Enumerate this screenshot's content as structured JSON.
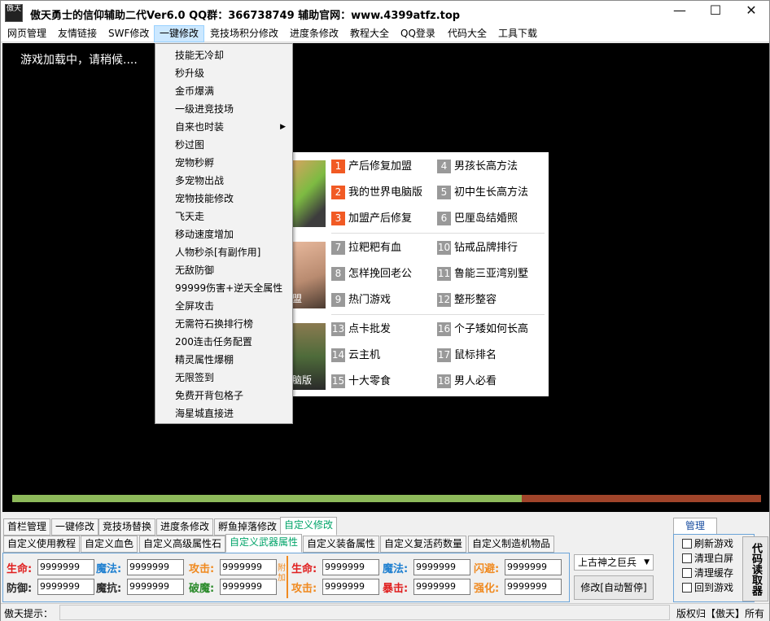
{
  "window": {
    "icon_text": "傲天",
    "title": "傲天勇士的信仰辅助二代Ver6.0   QQ群：366738749   辅助官网：www.4399atfz.top",
    "minimize": "—",
    "maximize": "☐",
    "close": "✕"
  },
  "menubar": [
    "网页管理",
    "友情链接",
    "SWF修改",
    "一键修改",
    "竞技场积分修改",
    "进度条修改",
    "教程大全",
    "QQ登录",
    "代码大全",
    "工具下载"
  ],
  "game": {
    "loading_text": "游戏加载中，请稍候....",
    "progress_fraction": 0.68
  },
  "dropdown": [
    "技能无冷却",
    "秒升级",
    "金币爆满",
    "一级进竞技场",
    "自来也时装",
    "秒过图",
    "宠物秒孵",
    "多宠物出战",
    "宠物技能修改",
    "飞天走",
    "移动速度增加",
    "人物秒杀[有副作用]",
    "无敌防御",
    "99999伤害+逆天全属性",
    "全屏攻击",
    "无需符石换排行榜",
    "200连击任务配置",
    "精灵属性爆棚",
    "无限签到",
    "免费开背包格子",
    "海星城直接进"
  ],
  "dropdown_submenu_arrow": "▶",
  "ad": {
    "thumb_captions": [
      "",
      "盟",
      "脑版"
    ],
    "items": [
      {
        "n": "1",
        "text": "产后修复加盟",
        "hot": true
      },
      {
        "n": "4",
        "text": "男孩长高方法",
        "hot": false
      },
      {
        "n": "2",
        "text": "我的世界电脑版",
        "hot": true
      },
      {
        "n": "5",
        "text": "初中生长高方法",
        "hot": false
      },
      {
        "n": "3",
        "text": "加盟产后修复",
        "hot": true
      },
      {
        "n": "6",
        "text": "巴厘岛结婚照",
        "hot": false
      },
      {
        "n": "7",
        "text": "拉粑粑有血",
        "hot": false
      },
      {
        "n": "10",
        "text": "钻戒品牌排行",
        "hot": false
      },
      {
        "n": "8",
        "text": "怎样挽回老公",
        "hot": false
      },
      {
        "n": "11",
        "text": "鲁能三亚湾别墅",
        "hot": false
      },
      {
        "n": "9",
        "text": "热门游戏",
        "hot": false
      },
      {
        "n": "12",
        "text": "整形整容",
        "hot": false
      },
      {
        "n": "13",
        "text": "点卡批发",
        "hot": false
      },
      {
        "n": "16",
        "text": "个子矮如何长高",
        "hot": false
      },
      {
        "n": "14",
        "text": "云主机",
        "hot": false
      },
      {
        "n": "17",
        "text": "鼠标排名",
        "hot": false
      },
      {
        "n": "15",
        "text": "十大零食",
        "hot": false
      },
      {
        "n": "18",
        "text": "男人必看",
        "hot": false
      }
    ]
  },
  "tabs_row1": [
    "首栏管理",
    "一键修改",
    "竞技场替换",
    "进度条修改",
    "孵鱼掉落修改",
    "自定义修改"
  ],
  "tabs_row2": [
    "自定义使用教程",
    "自定义血色",
    "自定义高级属性石",
    "自定义武器属性",
    "自定义装备属性",
    "自定义复活药数量",
    "自定义制造机物品"
  ],
  "fields": {
    "left": [
      {
        "label": "生命:",
        "value": "9999999",
        "color": "#e02020"
      },
      {
        "label": "魔法:",
        "value": "9999999",
        "color": "#2080d0"
      },
      {
        "label": "攻击:",
        "value": "9999999",
        "color": "#f08a20"
      },
      {
        "label": "防御:",
        "value": "9999999",
        "color": "#2a2a2a"
      },
      {
        "label": "魔抗:",
        "value": "9999999",
        "color": "#2a2a2a"
      },
      {
        "label": "破魔:",
        "value": "9999999",
        "color": "#2a8a2a"
      }
    ],
    "append": "附加",
    "right": [
      {
        "label": "生命:",
        "value": "9999999",
        "color": "#e02020"
      },
      {
        "label": "魔法:",
        "value": "9999999",
        "color": "#2080d0"
      },
      {
        "label": "闪避:",
        "value": "9999999",
        "color": "#f08a20"
      },
      {
        "label": "攻击:",
        "value": "9999999",
        "color": "#f08a20"
      },
      {
        "label": "暴击:",
        "value": "9999999",
        "color": "#e02020"
      },
      {
        "label": "强化:",
        "value": "9999999",
        "color": "#f08a20"
      }
    ]
  },
  "weapon_select": "上古神之巨兵",
  "modify_button": "修改[自动暂停]",
  "manage": {
    "title": "管理",
    "checks": [
      "刷新游戏",
      "清理白屏",
      "清理缓存",
      "回到游戏"
    ],
    "code_reader": "代码读取器"
  },
  "status": {
    "hint_label": "傲天提示：",
    "copyright": "版权归【傲天】所有"
  },
  "colors": {
    "accent": "#00a368",
    "highlight": "#cce8ff",
    "progress_done": "#8db95a",
    "progress_rest": "#a0442a",
    "hot_num": "#f15a24"
  }
}
